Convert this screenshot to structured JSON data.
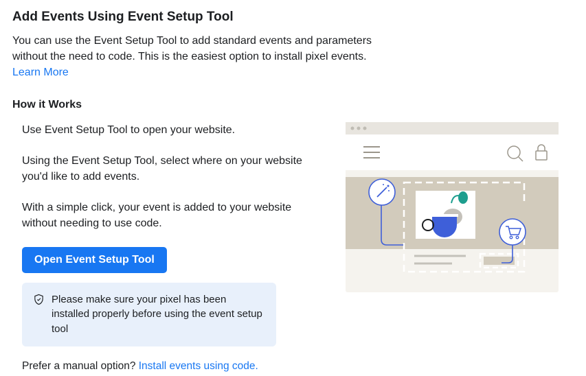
{
  "title": "Add Events Using Event Setup Tool",
  "intro": "You can use the Event Setup Tool to add standard events and parameters without the need to code. This is the easiest option to install pixel events. ",
  "learn_more": "Learn More",
  "how_it_works_title": "How it Works",
  "steps": [
    "Use Event Setup Tool to open your website.",
    "Using the Event Setup Tool, select where on your website you'd like to add events.",
    "With a simple click, your event is added to your website without needing to use code."
  ],
  "open_button": "Open Event Setup Tool",
  "info_message": "Please make sure your pixel has been installed properly before using the event setup tool",
  "manual_prefix": "Prefer a manual option? ",
  "manual_link": "Install events using code."
}
